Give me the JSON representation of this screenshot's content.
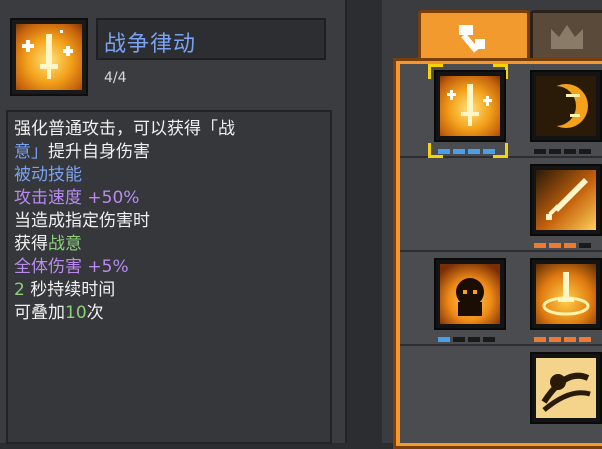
{
  "skill": {
    "name": "战争律动",
    "level": "4/4",
    "icon": "sword-sparkle-icon"
  },
  "description": {
    "line1": "强化普通攻击，可以获得「战",
    "line2a": "意」",
    "line2b": "提升自身伤害",
    "passive_label": "被动技能",
    "attack_speed_label": "攻击速度 +50%",
    "condition": "当造成指定伤害时",
    "gain_prefix": "获得",
    "gain_value": "战意",
    "team_damage": "全体伤害 +5%",
    "duration_value": "2",
    "duration_label": " 秒持续时间",
    "stack_prefix": "可叠加",
    "stack_value": "10",
    "stack_suffix": "次"
  },
  "tabs": [
    {
      "icon": "sword-hammer-icon",
      "active": true
    },
    {
      "icon": "crown-icon",
      "active": false
    }
  ],
  "colors": {
    "accent_orange": "#f29a2e",
    "title_blue": "#7aa2f0",
    "passive_purple": "#b98af0",
    "value_green": "#8cd07a"
  }
}
